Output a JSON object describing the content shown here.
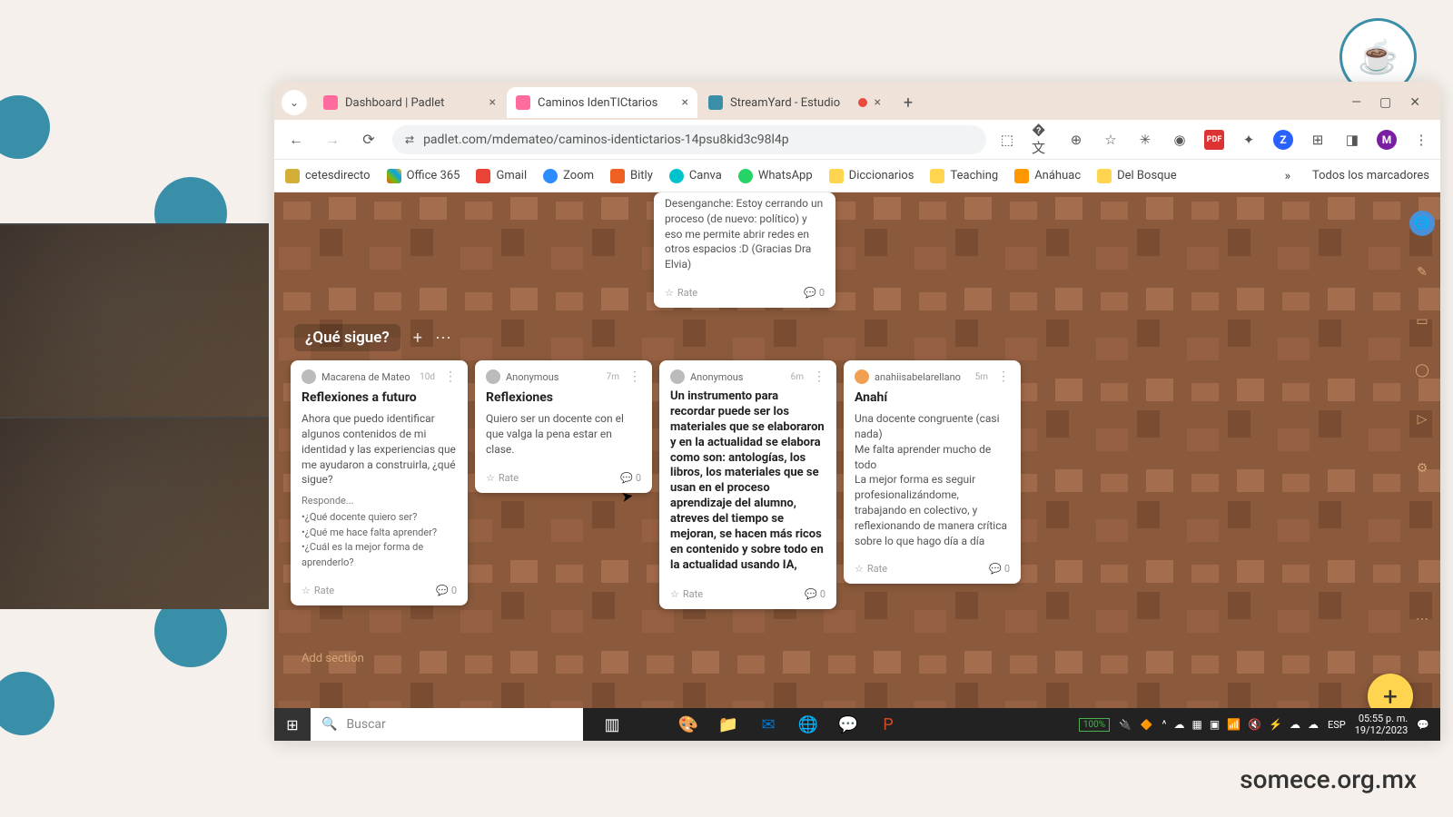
{
  "browser": {
    "tabs": [
      {
        "title": "Dashboard | Padlet",
        "active": false
      },
      {
        "title": "Caminos IdenTICtarios",
        "active": true
      },
      {
        "title": "StreamYard - Estudio",
        "active": false,
        "recording": true
      }
    ],
    "url": "padlet.com/mdemateo/caminos-identictarios-14psu8kid3c98l4p",
    "bookmarks": [
      "cetesdirecto",
      "Office 365",
      "Gmail",
      "Zoom",
      "Bitly",
      "Canva",
      "WhatsApp",
      "Diccionarios",
      "Teaching",
      "Anáhuac",
      "Del Bosque"
    ],
    "all_bookmarks": "Todos los marcadores"
  },
  "padlet": {
    "section_title": "¿Qué sigue?",
    "add_section": "Add section",
    "rate_label": "Rate",
    "top_card": {
      "body": "Desenganche: Estoy cerrando un proceso (de nuevo: político) y eso me permite abrir redes en otros espacios :D (Gracias Dra Elvia)",
      "comments": "0"
    },
    "cards": [
      {
        "author": "Macarena de Mateo",
        "time": "10d",
        "title": "Reflexiones a futuro",
        "body": "Ahora que puedo identificar algunos contenidos de mi identidad y las experiencias que me ayudaron a construirla, ¿qué sigue?",
        "sub": "Responde...",
        "bullets": [
          "•¿Qué docente quiero ser?",
          "•¿Qué me hace falta aprender?",
          "•¿Cuál es la mejor forma de aprenderlo?"
        ],
        "comments": "0"
      },
      {
        "author": "Anonymous",
        "time": "7m",
        "title": "Reflexiones",
        "body": "Quiero ser un docente con el que valga la pena estar en clase.",
        "comments": "0"
      },
      {
        "author": "Anonymous",
        "time": "6m",
        "title": "Un instrumento para recordar puede ser los materiales que se elaboraron y en la actualidad se elabora como son:  antologías, los libros, los materiales que se usan en el proceso aprendizaje del alumno, atreves del tiempo se mejoran, se hacen más ricos en contenido y sobre todo en la actualidad usando IA,",
        "body": "",
        "comments": "0"
      },
      {
        "author": "anahiisabelarellano",
        "time": "5m",
        "title": "Anahí",
        "body": "Una docente congruente (casi nada)\nMe falta aprender mucho de todo\nLa mejor forma es seguir profesionalizándome, trabajando en colectivo, y reflexionando de manera crítica sobre lo que hago día a día",
        "comments": "0"
      }
    ]
  },
  "taskbar": {
    "search_placeholder": "Buscar",
    "battery": "100%",
    "lang": "ESP",
    "time": "05:55 p. m.",
    "date": "19/12/2023"
  },
  "footer_brand": "somece.org.mx"
}
